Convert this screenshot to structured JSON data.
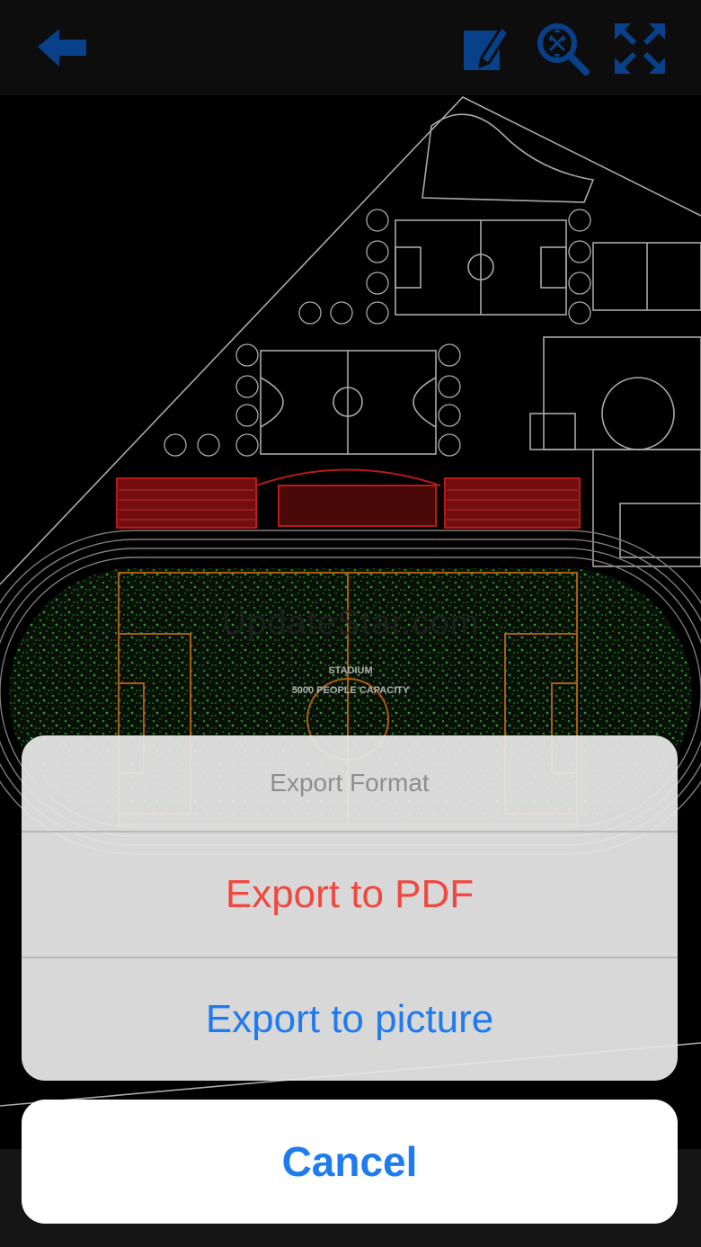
{
  "toolbar": {
    "back_icon": "arrow-left-icon",
    "edit_icon": "edit-markup-icon",
    "zoom_icon": "zoom-fit-icon",
    "fullscreen_icon": "fullscreen-icon",
    "icon_color": "#0a4fa8"
  },
  "drawing": {
    "watermark": "UpdateStar.com",
    "stadium_title": "STADIUM",
    "stadium_capacity": "5000 PEOPLE CAPACITY",
    "colors": {
      "lines": "#cfcfcf",
      "grass": "#1f8a1f",
      "bleachers": "#c0181a",
      "field_lines": "#d1711a"
    }
  },
  "action_sheet": {
    "title": "Export Format",
    "options": [
      {
        "label": "Export to PDF",
        "color": "#f0493f"
      },
      {
        "label": "Export to picture",
        "color": "#1e7bf0"
      }
    ],
    "cancel_label": "Cancel"
  }
}
